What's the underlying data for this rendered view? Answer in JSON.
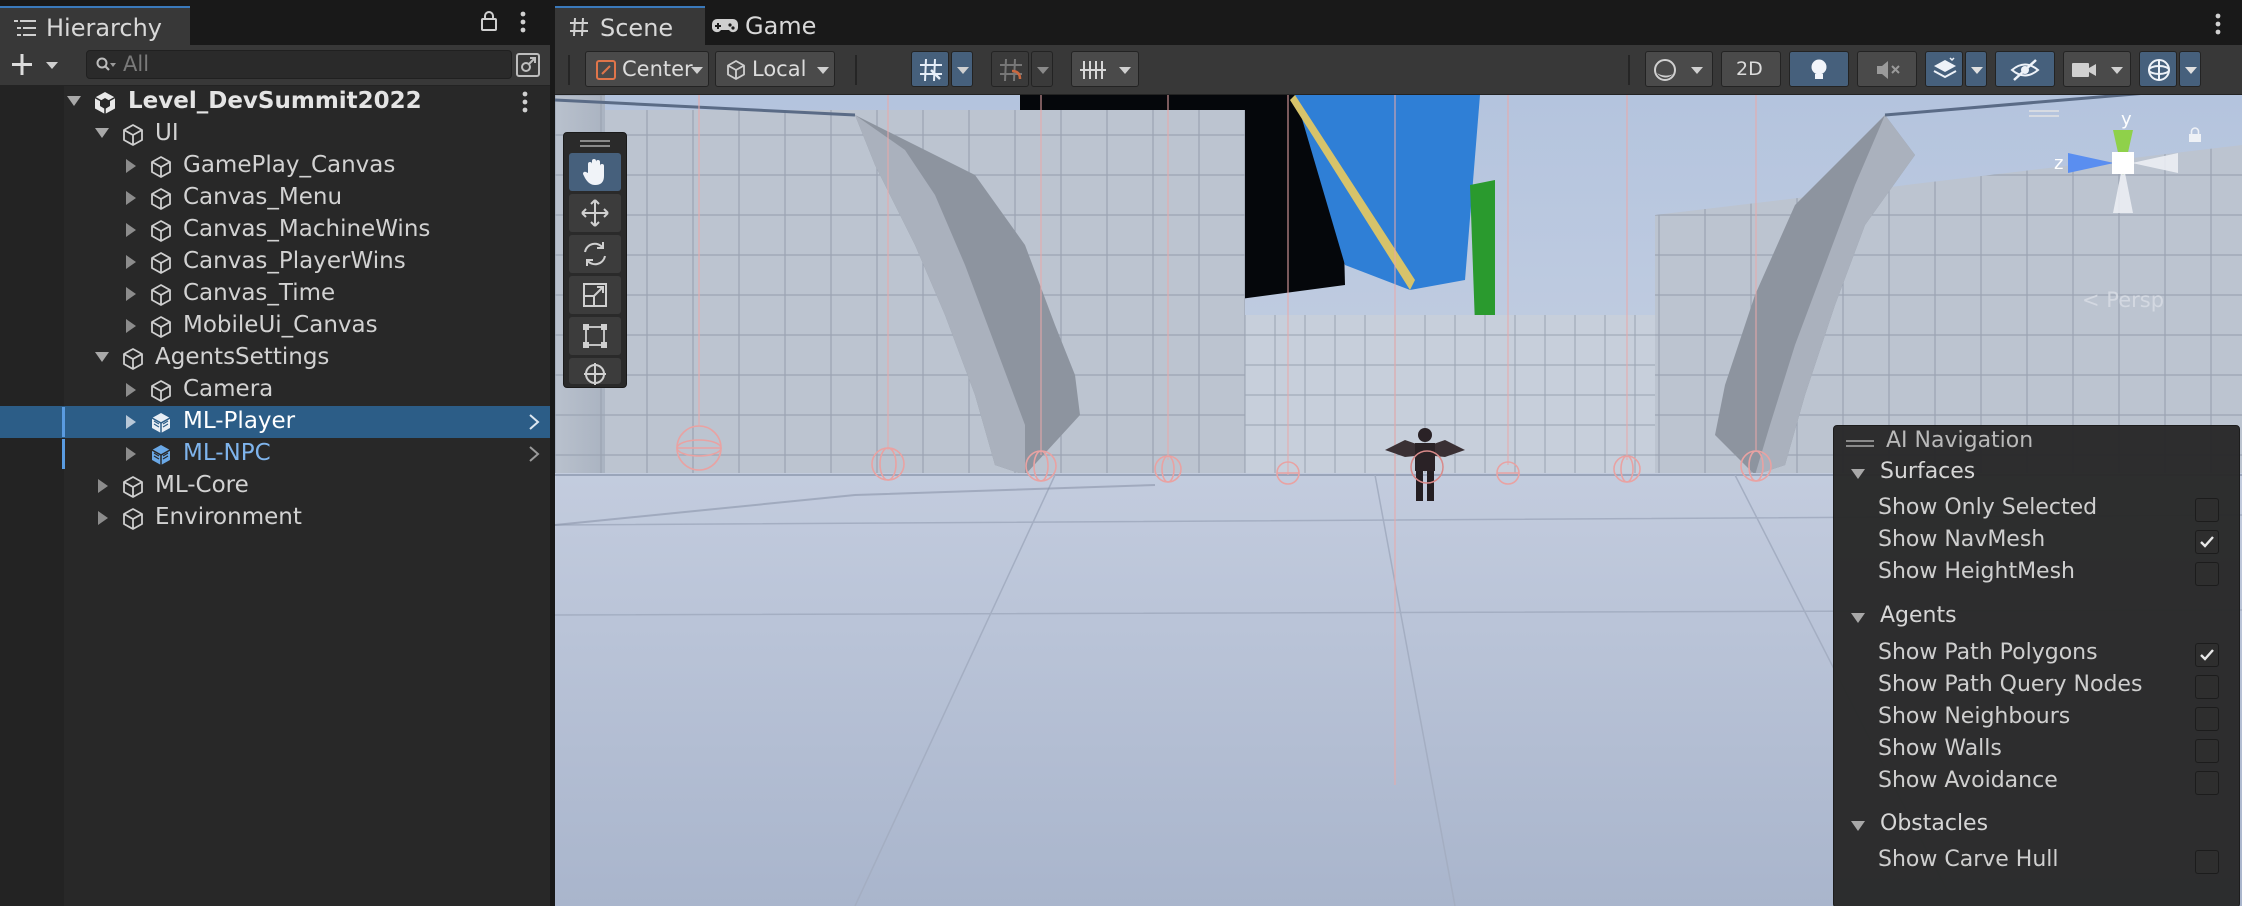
{
  "hierarchy": {
    "tab_label": "Hierarchy",
    "search_placeholder": "All",
    "scene_root": "Level_DevSummit2022",
    "items": [
      {
        "label": "UI",
        "depth": 1,
        "expanded": true,
        "has_children": true
      },
      {
        "label": "GamePlay_Canvas",
        "depth": 2,
        "has_children": true
      },
      {
        "label": "Canvas_Menu",
        "depth": 2,
        "has_children": true
      },
      {
        "label": "Canvas_MachineWins",
        "depth": 2,
        "has_children": true
      },
      {
        "label": "Canvas_PlayerWins",
        "depth": 2,
        "has_children": true
      },
      {
        "label": "Canvas_Time",
        "depth": 2,
        "has_children": true
      },
      {
        "label": "MobileUi_Canvas",
        "depth": 2,
        "has_children": true
      },
      {
        "label": "AgentsSettings",
        "depth": 1,
        "expanded": true,
        "has_children": true
      },
      {
        "label": "Camera",
        "depth": 2,
        "has_children": true
      },
      {
        "label": "ML-Player",
        "depth": 2,
        "has_children": true,
        "prefab": true,
        "selected": true
      },
      {
        "label": "ML-NPC",
        "depth": 2,
        "has_children": true,
        "prefab": true
      },
      {
        "label": "ML-Core",
        "depth": 1,
        "has_children": true
      },
      {
        "label": "Environment",
        "depth": 1,
        "has_children": true
      }
    ]
  },
  "scene": {
    "tabs": [
      {
        "label": "Scene",
        "icon": "grid-hash-icon",
        "active": true
      },
      {
        "label": "Game",
        "icon": "gamepad-icon",
        "active": false
      }
    ],
    "toolbar": {
      "pivot_mode": "Center",
      "pivot_rotation": "Local",
      "toggle_2d": "2D"
    },
    "persp_label": "Persp",
    "gizmo_axes": {
      "y": "y",
      "z": "z"
    },
    "tools": [
      "hand-tool",
      "move-tool",
      "rotate-tool",
      "scale-tool",
      "rect-tool",
      "transform-tool"
    ]
  },
  "ai_navigation": {
    "title": "AI Navigation",
    "sections": [
      {
        "label": "Surfaces",
        "options": [
          {
            "label": "Show Only Selected",
            "checked": false
          },
          {
            "label": "Show NavMesh",
            "checked": true
          },
          {
            "label": "Show HeightMesh",
            "checked": false
          }
        ]
      },
      {
        "label": "Agents",
        "options": [
          {
            "label": "Show Path Polygons",
            "checked": true
          },
          {
            "label": "Show Path Query Nodes",
            "checked": false
          },
          {
            "label": "Show Neighbours",
            "checked": false
          },
          {
            "label": "Show Walls",
            "checked": false
          },
          {
            "label": "Show Avoidance",
            "checked": false
          }
        ]
      },
      {
        "label": "Obstacles",
        "options": [
          {
            "label": "Show Carve Hull",
            "checked": false
          }
        ]
      }
    ]
  },
  "colors": {
    "selection": "#2c5d87",
    "accent": "#3a79bb",
    "prefab": "#7fb4ec",
    "panel": "#282828",
    "toolbar": "#383838"
  }
}
